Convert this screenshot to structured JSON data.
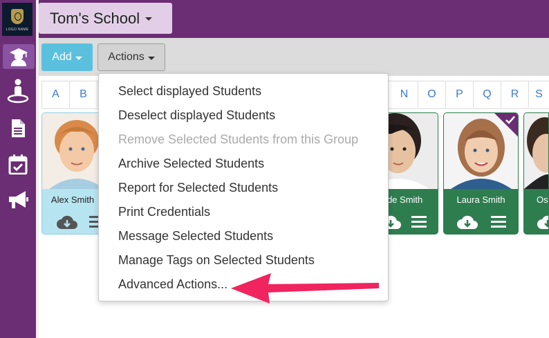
{
  "logo": {
    "text": "LOGO NAME"
  },
  "sidebar": {
    "items": [
      {
        "icon": "graduate-icon",
        "active": true
      },
      {
        "icon": "person-pin-icon",
        "active": false
      },
      {
        "icon": "document-icon",
        "active": false
      },
      {
        "icon": "calendar-check-icon",
        "active": false
      },
      {
        "icon": "megaphone-icon",
        "active": false
      }
    ]
  },
  "header": {
    "school_name": "Tom's School"
  },
  "toolbar": {
    "add_label": "Add",
    "actions_label": "Actions"
  },
  "alphabet": {
    "left": [
      "A",
      "B"
    ],
    "right": [
      "N",
      "O",
      "P",
      "Q",
      "R",
      "S"
    ]
  },
  "students": [
    {
      "name": "Alex Smith",
      "selected": false,
      "color": "blue"
    },
    {
      "name": "ade Smith",
      "selected": false,
      "color": "green"
    },
    {
      "name": "Laura Smith",
      "selected": true,
      "color": "green"
    },
    {
      "name": "Os",
      "selected": false,
      "color": "green"
    }
  ],
  "actions_menu": {
    "items": [
      {
        "label": "Select displayed Students",
        "enabled": true
      },
      {
        "label": "Deselect displayed Students",
        "enabled": true
      },
      {
        "label": "Remove Selected Students from this Group",
        "enabled": false
      },
      {
        "label": "Archive Selected Students",
        "enabled": true
      },
      {
        "label": "Report for Selected Students",
        "enabled": true
      },
      {
        "label": "Print Credentials",
        "enabled": true
      },
      {
        "label": "Message Selected Students",
        "enabled": true
      },
      {
        "label": "Manage Tags on Selected Students",
        "enabled": true
      },
      {
        "label": "Advanced Actions...",
        "enabled": true
      }
    ]
  },
  "colors": {
    "brand_purple": "#6b2d74",
    "add_button": "#5bc0de",
    "card_green": "#2e7d4f",
    "card_blue": "#b7e4f1",
    "arrow": "#f0245e",
    "link_blue": "#3a7bd5"
  }
}
